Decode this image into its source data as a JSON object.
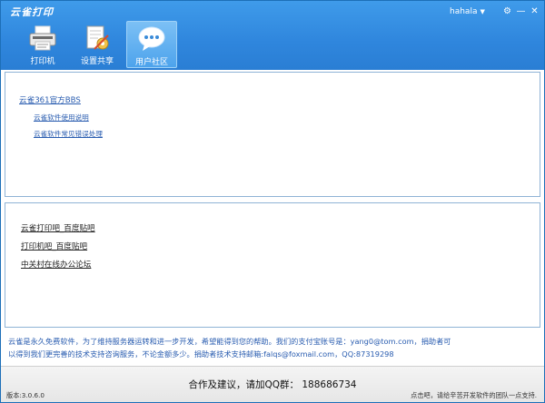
{
  "window": {
    "title": "云雀打印",
    "user": "hahala",
    "caret": "▼",
    "controls": {
      "settings": "⚙",
      "minimize": "—",
      "close": "✕"
    }
  },
  "tabs": [
    {
      "label": "打印机",
      "icon": "printer-icon",
      "active": false
    },
    {
      "label": "设置共享",
      "icon": "share-settings-icon",
      "active": false
    },
    {
      "label": "用户社区",
      "icon": "chat-bubble-icon",
      "active": true
    }
  ],
  "top_links": {
    "bbs": "云雀361官方BBS",
    "guide": "云雀软件使用说明",
    "faq": "云雀软件常见错误处理"
  },
  "mid_links": {
    "tieba1": "云雀打印吧_百度贴吧",
    "tieba2": "打印机吧_百度贴吧",
    "zol": "中关村在线办公论坛"
  },
  "notice": {
    "line1": "云雀是永久免费软件，为了维持服务器运转和进一步开发，希望能得到您的帮助。我们的支付宝账号是：yang0@tom.com，捐助者可",
    "line2": "以得到我们更完善的技术支持咨询服务，不论金额多少。捐助者技术支持邮箱:falqs@foxmail.com，QQ:87319298"
  },
  "footer": {
    "contact": "合作及建议，请加QQ群：   188686734",
    "version": "版本:3.0.6.0",
    "status": "点击吧，请给辛苦开发软件的团队一点支持."
  },
  "colors": {
    "header_blue": "#2f86dd",
    "link_blue": "#2a5db0",
    "panel_border": "#8fb3d6"
  }
}
